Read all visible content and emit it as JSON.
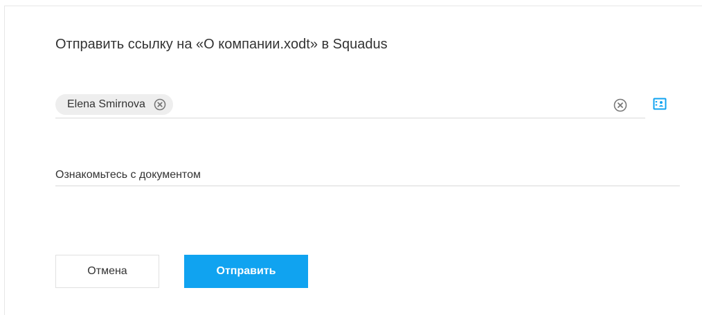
{
  "dialog": {
    "title": "Отправить ссылку на «О компании.xodt» в Squadus"
  },
  "recipients": {
    "chips": [
      {
        "label": "Elena Smirnova"
      }
    ],
    "remove_icon": "close-circle-icon",
    "clear_icon": "close-circle-icon",
    "contacts_icon": "contact-card-icon"
  },
  "message": {
    "value": "Ознакомьтесь с документом"
  },
  "buttons": {
    "cancel_label": "Отмена",
    "send_label": "Отправить"
  },
  "colors": {
    "accent": "#10a3f0",
    "chip_bg": "#eeeeee",
    "divider": "#d9d9d9"
  }
}
